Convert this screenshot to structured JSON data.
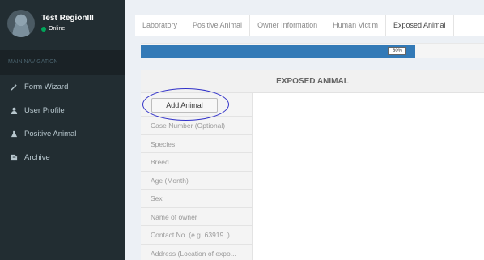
{
  "user": {
    "name": "Test RegionIII",
    "status": "Online"
  },
  "nav": {
    "header": "MAIN NAVIGATION",
    "items": [
      {
        "label": "Form Wizard",
        "icon": "magic-wand-icon"
      },
      {
        "label": "User Profile",
        "icon": "user-icon"
      },
      {
        "label": "Positive Animal",
        "icon": "flask-icon"
      },
      {
        "label": "Archive",
        "icon": "archive-icon"
      }
    ]
  },
  "tabs": [
    "Laboratory",
    "Positive Animal",
    "Owner Information",
    "Human Victim",
    "Exposed Animal"
  ],
  "active_tab": "Exposed Animal",
  "progress": {
    "label": "80%",
    "value": 0.8
  },
  "panel": {
    "title": "EXPOSED ANIMAL",
    "add_button": "Add Animal",
    "fields": [
      "Case Number (Optional)",
      "Species",
      "Breed",
      "Age (Month)",
      "Sex",
      "Name of owner",
      "Contact No. (e.g. 63919..)",
      "Address (Location of expo..."
    ]
  },
  "colors": {
    "sidebar": "#222d32",
    "progress": "#337ab7",
    "online": "#00a65a",
    "highlight": "#3030c8"
  }
}
